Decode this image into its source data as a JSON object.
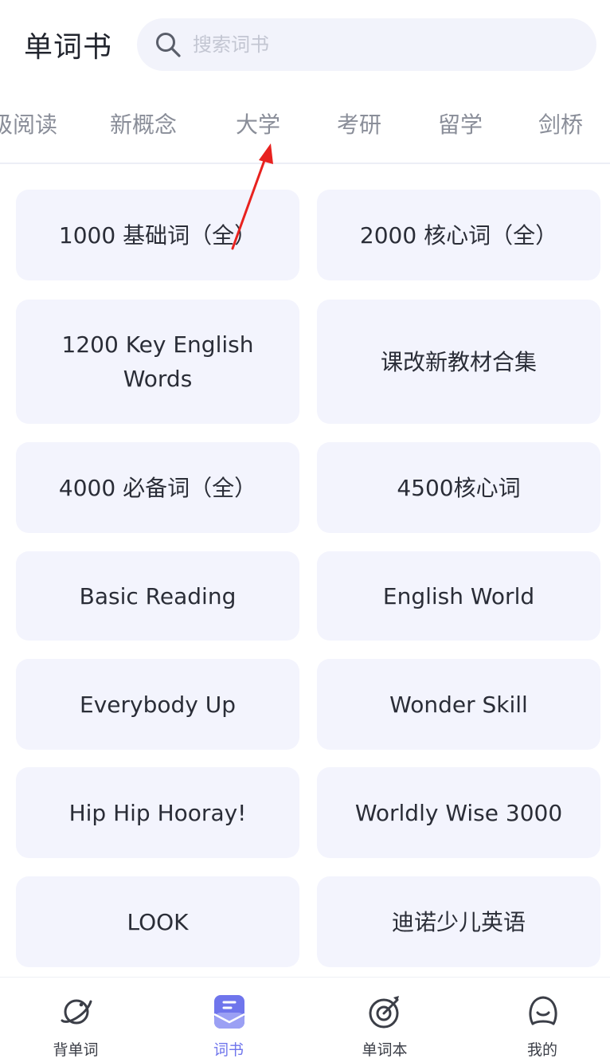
{
  "header": {
    "title": "单词书",
    "search_placeholder": "搜索词书",
    "search_icon": "search-icon"
  },
  "tabs": [
    {
      "label": "级阅读"
    },
    {
      "label": "新概念"
    },
    {
      "label": "大学"
    },
    {
      "label": "考研"
    },
    {
      "label": "留学"
    },
    {
      "label": "剑桥"
    }
  ],
  "books": [
    {
      "title": "1000 基础词（全）"
    },
    {
      "title": "2000 核心词（全）"
    },
    {
      "title": "1200 Key English Words"
    },
    {
      "title": "课改新教材合集"
    },
    {
      "title": "4000 必备词（全）"
    },
    {
      "title": "4500核心词"
    },
    {
      "title": "Basic Reading"
    },
    {
      "title": "English World"
    },
    {
      "title": "Everybody Up"
    },
    {
      "title": "Wonder Skill"
    },
    {
      "title": "Hip Hip Hooray!"
    },
    {
      "title": "Worldly Wise 3000"
    },
    {
      "title": "LOOK"
    },
    {
      "title": "迪诺少儿英语"
    }
  ],
  "bottom_nav": [
    {
      "label": "背单词",
      "icon": "planet-icon"
    },
    {
      "label": "词书",
      "icon": "book-icon",
      "active": true
    },
    {
      "label": "单词本",
      "icon": "target-icon"
    },
    {
      "label": "我的",
      "icon": "user-icon"
    }
  ],
  "colors": {
    "accent": "#6f75ec",
    "card_background": "#f3f4fd",
    "annotation_arrow": "#e8221f"
  }
}
